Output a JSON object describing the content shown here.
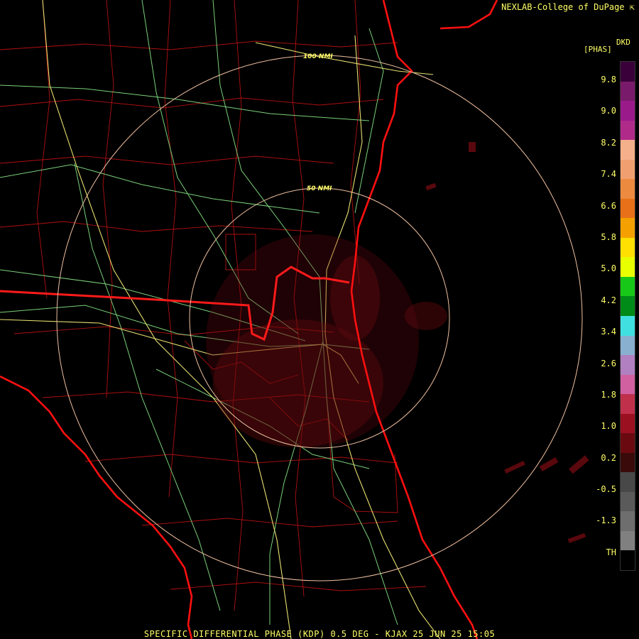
{
  "header": {
    "credit": "NEXLAB-College of DuPage",
    "credit_icon": "external-link-arrow-icon"
  },
  "legend": {
    "product_code": "DKD",
    "units": "[PHAS]",
    "labels": [
      "9.8",
      "9.0",
      "8.2",
      "7.4",
      "6.6",
      "5.8",
      "5.0",
      "4.2",
      "3.4",
      "2.6",
      "1.8",
      "1.0",
      "0.2",
      "-0.5",
      "-1.3",
      "TH"
    ],
    "colors": [
      "#3a003a",
      "#7a1a6a",
      "#9a1a8a",
      "#b02a8a",
      "#f4b08a",
      "#f0a070",
      "#ec8a40",
      "#e87018",
      "#f4a000",
      "#ffe000",
      "#e8ff00",
      "#18c818",
      "#008a18",
      "#40e0e0",
      "#8ab0d0",
      "#b080c0",
      "#d060a0",
      "#c0304a",
      "#9a1020",
      "#6a0a10",
      "#3a0a0a",
      "#484848",
      "#5a5a5a",
      "#6e6e6e",
      "#808080",
      "#000000"
    ]
  },
  "map": {
    "range_rings": [
      {
        "label": "50 NMI"
      },
      {
        "label": "100 NMI"
      }
    ],
    "colors": {
      "background": "#000000",
      "county": "#b01010",
      "state": "#ff1a1a",
      "coast": "#ff1010",
      "highway_green": "#7ad07a",
      "highway_yellow": "#e8e070",
      "ring": "#f0c0a0",
      "echo": "#6a0a10"
    }
  },
  "footer": {
    "caption": "SPECIFIC DIFFERENTIAL PHASE (KDP) 0.5 DEG - KJAX 25 JUN 25 15:05"
  }
}
